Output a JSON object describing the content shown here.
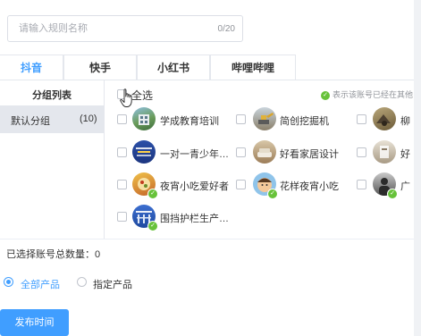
{
  "rule_name": {
    "placeholder": "请输入规则名称",
    "counter": "0/20"
  },
  "tabs": [
    {
      "label": "抖音",
      "active": true
    },
    {
      "label": "快手",
      "active": false
    },
    {
      "label": "小红书",
      "active": false
    },
    {
      "label": "哔哩哔哩",
      "active": false
    }
  ],
  "groups": {
    "title": "分组列表",
    "items": [
      {
        "name": "默认分组",
        "count": "(10)"
      }
    ]
  },
  "accounts": {
    "select_all": "全选",
    "hint": "表示该账号已经在其他",
    "items": [
      {
        "name": "学成教育培训",
        "avatar": "building-avatar",
        "bound": false
      },
      {
        "name": "简创挖掘机",
        "avatar": "excavator-avatar",
        "bound": false
      },
      {
        "name": "柳",
        "avatar": "machinery-avatar",
        "bound": false
      },
      {
        "name": "一对一青少年…",
        "avatar": "education-banner-avatar",
        "bound": false
      },
      {
        "name": "好看家居设计",
        "avatar": "furniture-avatar",
        "bound": false
      },
      {
        "name": "好",
        "avatar": "interior-avatar",
        "bound": false
      },
      {
        "name": "夜宵小吃爱好者",
        "avatar": "food-avatar",
        "bound": true
      },
      {
        "name": "花样夜宵小吃",
        "avatar": "cartoon-avatar",
        "bound": true
      },
      {
        "name": "广",
        "avatar": "person-avatar",
        "bound": true
      },
      {
        "name": "围挡护栏生产…",
        "avatar": "fence-avatar",
        "bound": true
      }
    ]
  },
  "summary": {
    "label": "已选择账号总数量：0"
  },
  "product_scope": {
    "all": "全部产品",
    "specific": "指定产品",
    "selected": "全部产品"
  },
  "publish_button": "发布时间",
  "colors": {
    "primary": "#409eff",
    "success": "#67c23a"
  }
}
